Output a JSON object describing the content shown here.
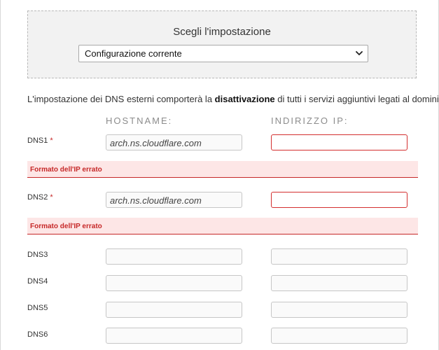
{
  "setting": {
    "title": "Scegli l'impostazione",
    "selected_option": "Configurazione corrente"
  },
  "notice": {
    "before": "L'impostazione dei DNS esterni comporterà la ",
    "bold": "disattivazione",
    "after": " di tutti i servizi aggiuntivi legati al dominio."
  },
  "columns": {
    "hostname": "HOSTNAME:",
    "ip": "INDIRIZZO IP:"
  },
  "required_mark": "*",
  "dns": [
    {
      "label": "DNS1",
      "hostname": "arch.ns.cloudflare.com",
      "ip": "",
      "error": "Formato dell'IP errato"
    },
    {
      "label": "DNS2",
      "hostname": "arch.ns.cloudflare.com",
      "ip": "",
      "error": "Formato dell'IP errato"
    },
    {
      "label": "DNS3",
      "hostname": "",
      "ip": ""
    },
    {
      "label": "DNS4",
      "hostname": "",
      "ip": ""
    },
    {
      "label": "DNS5",
      "hostname": "",
      "ip": ""
    },
    {
      "label": "DNS6",
      "hostname": "",
      "ip": ""
    }
  ],
  "colors": {
    "error": "#c62828",
    "error_background": "#fde6e6",
    "panel_background": "#f2f2f2"
  },
  "icons": {
    "select_arrow": "chevron-down-icon"
  }
}
